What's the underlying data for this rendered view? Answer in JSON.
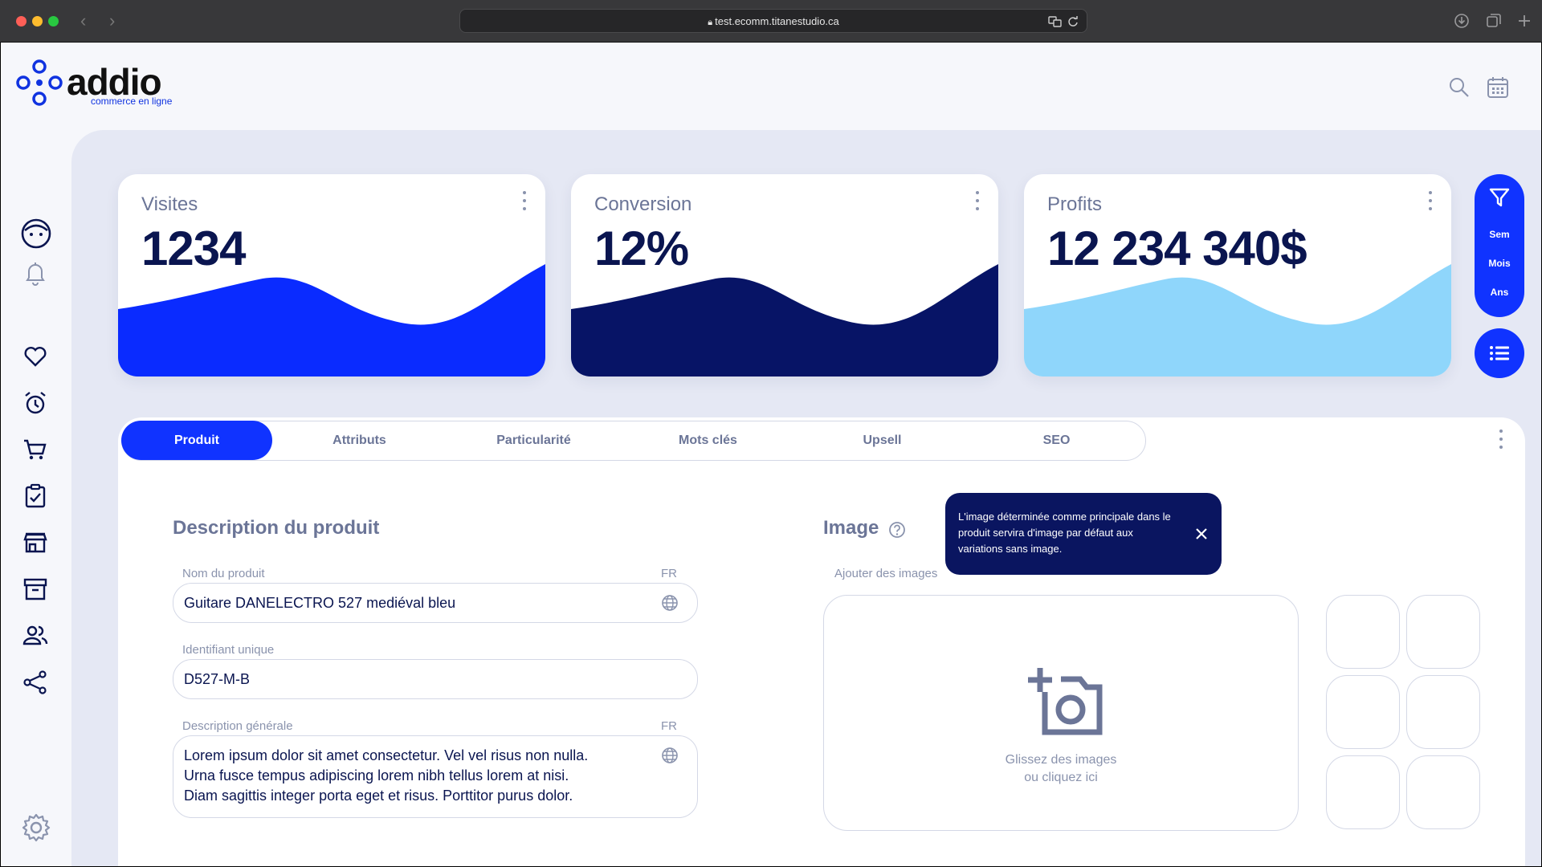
{
  "browser": {
    "url": "test.ecomm.titanestudio.ca"
  },
  "brand": {
    "name": "addio",
    "tagline": "commerce en ligne",
    "accent": "#1033ff"
  },
  "stats": [
    {
      "title": "Visites",
      "value": "1234",
      "color": "#0a2bff"
    },
    {
      "title": "Conversion",
      "value": "12%",
      "color": "#071466"
    },
    {
      "title": "Profits",
      "value": "12 234 340$",
      "color": "#8fd6fb"
    }
  ],
  "filter": {
    "options": [
      "Sem",
      "Mois",
      "Ans"
    ]
  },
  "tabs": [
    "Produit",
    "Attributs",
    "Particularité",
    "Mots clés",
    "Upsell",
    "SEO"
  ],
  "product": {
    "section_title": "Description du produit",
    "name_label": "Nom du produit",
    "name_lang": "FR",
    "name_value": "Guitare DANELECTRO 527 mediéval bleu",
    "id_label": "Identifiant unique",
    "id_value": "D527-M-B",
    "desc_label": "Description générale",
    "desc_lang": "FR",
    "desc_lines": [
      "Lorem ipsum dolor sit amet consectetur. Vel vel risus non nulla.",
      "Urna fusce tempus adipiscing lorem nibh tellus lorem at nisi.",
      "Diam sagittis integer porta eget et risus. Porttitor purus dolor."
    ]
  },
  "image": {
    "section_title": "Image",
    "add_label": "Ajouter des images",
    "drop_line1": "Glissez des images",
    "drop_line2": "ou cliquez ici",
    "tooltip": "L'image déterminée comme principale dans le produit servira d'image par défaut aux variations sans image."
  }
}
